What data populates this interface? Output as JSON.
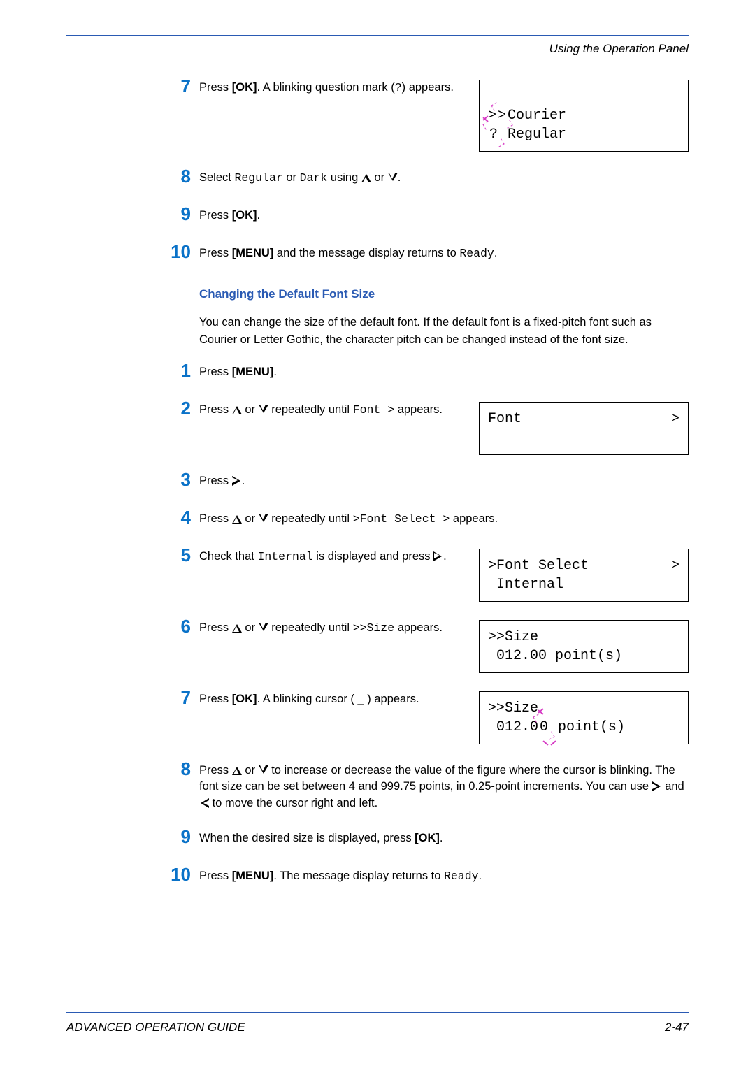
{
  "running_head": "Using the Operation Panel",
  "section1": {
    "step7": {
      "num": "7",
      "text_before_ok": "Press ",
      "ok_label": "[OK]",
      "text_after_ok": ". A blinking question mark (",
      "qmark": "?",
      "text_tail": ") appears.",
      "lcd_line1_prefix": ">",
      "lcd_line1_gt": ">",
      "lcd_line1_rest": "Courier",
      "lcd_line2_q": "?",
      "lcd_line2_rest": " Regular"
    },
    "step8": {
      "num": "8",
      "t1": "Select ",
      "m1": "Regular",
      "t2": " or ",
      "m2": "Dark",
      "t3": " using ",
      "t_or": " or ",
      "t_end": "."
    },
    "step9": {
      "num": "9",
      "t1": "Press ",
      "ok_label": "[OK]",
      "t_end": "."
    },
    "step10": {
      "num": "10",
      "t1": "Press ",
      "menu_label": "[MENU]",
      "t2": " and the message display returns to ",
      "m1": "Ready",
      "t_end": "."
    }
  },
  "heading": "Changing the Default Font Size",
  "intro": "You can change the size of the default font. If the default font is a fixed-pitch font such as Courier or Letter Gothic, the character pitch can be changed instead of the font size.",
  "section2": {
    "step1": {
      "num": "1",
      "t1": "Press ",
      "menu_label": "[MENU]",
      "t_end": "."
    },
    "step2": {
      "num": "2",
      "t1": "Press ",
      "t_or": " or ",
      "t2": " repeatedly until ",
      "m1": "Font  >",
      "t3": " appears.",
      "lcd_left": "Font",
      "lcd_right": ">"
    },
    "step3": {
      "num": "3",
      "t1": "Press ",
      "t_end": "."
    },
    "step4": {
      "num": "4",
      "t1": "Press ",
      "t_or": " or ",
      "t2": " repeatedly until ",
      "m1": ">Font  Select  >",
      "t3": " appears."
    },
    "step5": {
      "num": "5",
      "t1": "Check that ",
      "m1": "Internal",
      "t2": " is displayed and press ",
      "t_end": ".",
      "lcd_left": ">Font Select",
      "lcd_right": ">",
      "lcd_line2": " Internal"
    },
    "step6": {
      "num": "6",
      "t1": "Press ",
      "t_or": " or ",
      "t2": " repeatedly until ",
      "m1": ">>Size",
      "t3": " appears.",
      "lcd_line1": ">>Size",
      "lcd_line2": " 012.00 point(s)"
    },
    "step7": {
      "num": "7",
      "t1": "Press ",
      "ok_label": "[OK]",
      "t2": ". A blinking cursor ( _ ) appears.",
      "lcd_line1": ">>Size",
      "lcd_line2_a": " 012.0",
      "lcd_line2_blink": "0",
      "lcd_line2_b": " point(s)"
    },
    "step8": {
      "num": "8",
      "t1": "Press ",
      "t_or": " or ",
      "t2": " to increase or decrease the value of the figure where the cursor is blinking. The font size can be set between 4 and 999.75 points, in 0.25-point increments. You can use ",
      "t_and": " and ",
      "t3": " to move the cursor right and left."
    },
    "step9": {
      "num": "9",
      "t1": "When the desired size is displayed, press ",
      "ok_label": "[OK]",
      "t_end": "."
    },
    "step10": {
      "num": "10",
      "t1": "Press ",
      "menu_label": "[MENU]",
      "t2": ". The message display returns to ",
      "m1": "Ready",
      "t_end": "."
    }
  },
  "footer": {
    "left": "ADVANCED OPERATION GUIDE",
    "right": "2-47"
  }
}
